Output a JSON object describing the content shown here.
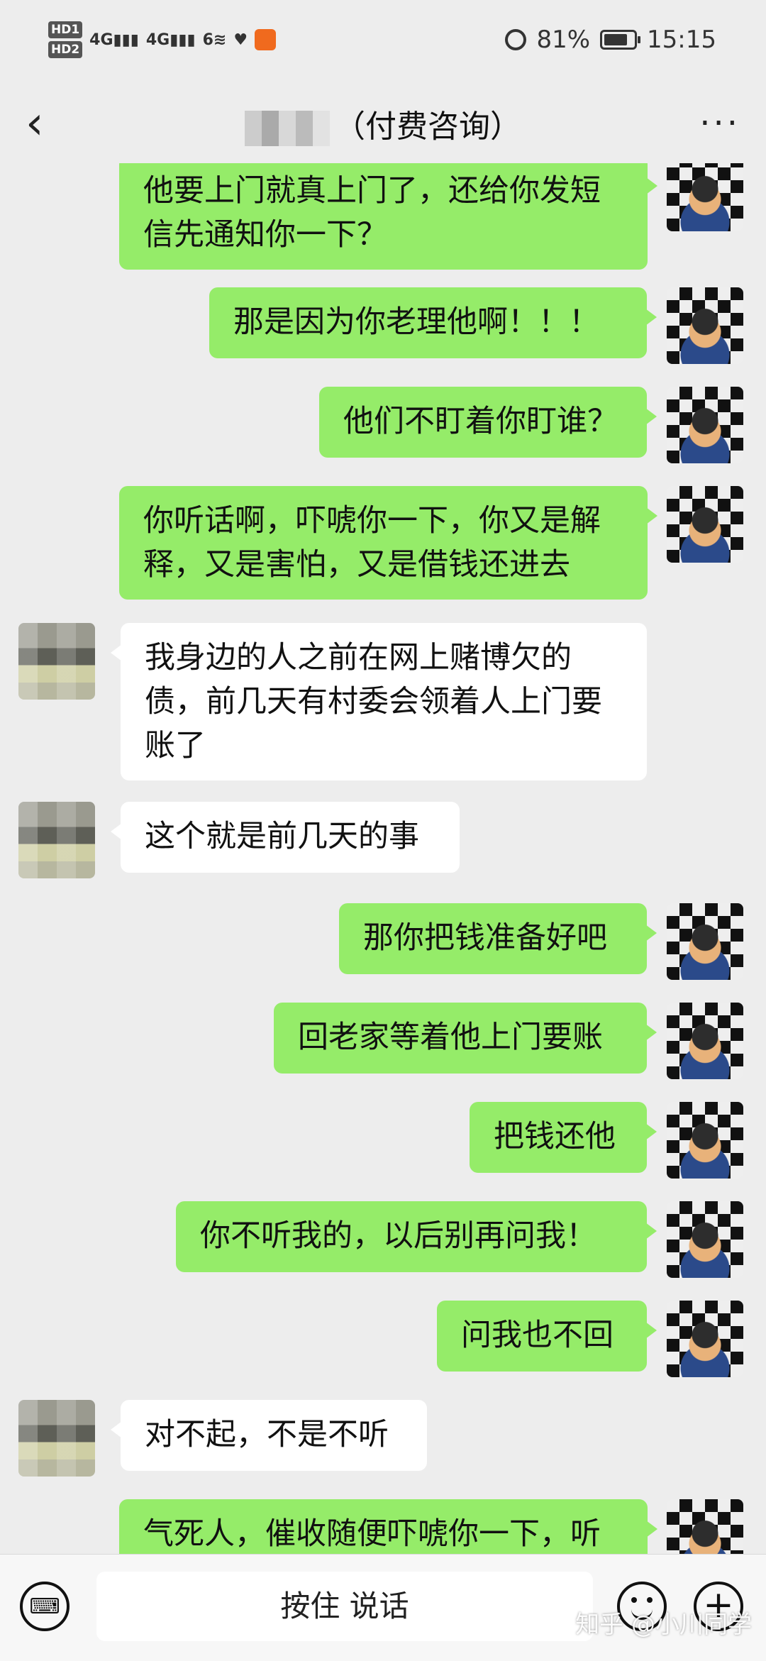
{
  "status_bar": {
    "hd1": "HD1",
    "hd2": "HD2",
    "net1": "4G",
    "net2": "4G",
    "net3": "6",
    "battery_percent": "81%",
    "battery_level": 0.81,
    "time": "15:15"
  },
  "header": {
    "title_suffix": "（付费咨询）",
    "back_icon": "chevron-left-icon",
    "more_label": "···"
  },
  "messages": [
    {
      "side": "out",
      "text": "他要上门就真上门了，还给你发短信先通知你一下？"
    },
    {
      "side": "out",
      "text": "那是因为你老理他啊！！！"
    },
    {
      "side": "out",
      "text": "他们不盯着你盯谁？"
    },
    {
      "side": "out",
      "text": "你听话啊，吓唬你一下，你又是解释，又是害怕，又是借钱还进去"
    },
    {
      "side": "in",
      "text": "我身边的人之前在网上赌博欠的债，前几天有村委会领着人上门要账了"
    },
    {
      "side": "in",
      "text": "这个就是前几天的事"
    },
    {
      "side": "out",
      "text": "那你把钱准备好吧"
    },
    {
      "side": "out",
      "text": "回老家等着他上门要账"
    },
    {
      "side": "out",
      "text": "把钱还他"
    },
    {
      "side": "out",
      "text": "你不听我的，以后别再问我！"
    },
    {
      "side": "out",
      "text": "问我也不回"
    },
    {
      "side": "in",
      "text": "对不起，不是不听"
    },
    {
      "side": "out",
      "text": "气死人，催收随便吓唬你一下，听"
    }
  ],
  "input_bar": {
    "hold_to_talk": "按住 说话",
    "keyboard_icon": "keyboard-icon",
    "emoji_icon": "emoji-icon",
    "plus_icon": "plus-icon"
  },
  "watermark": "知乎 @小川同学"
}
